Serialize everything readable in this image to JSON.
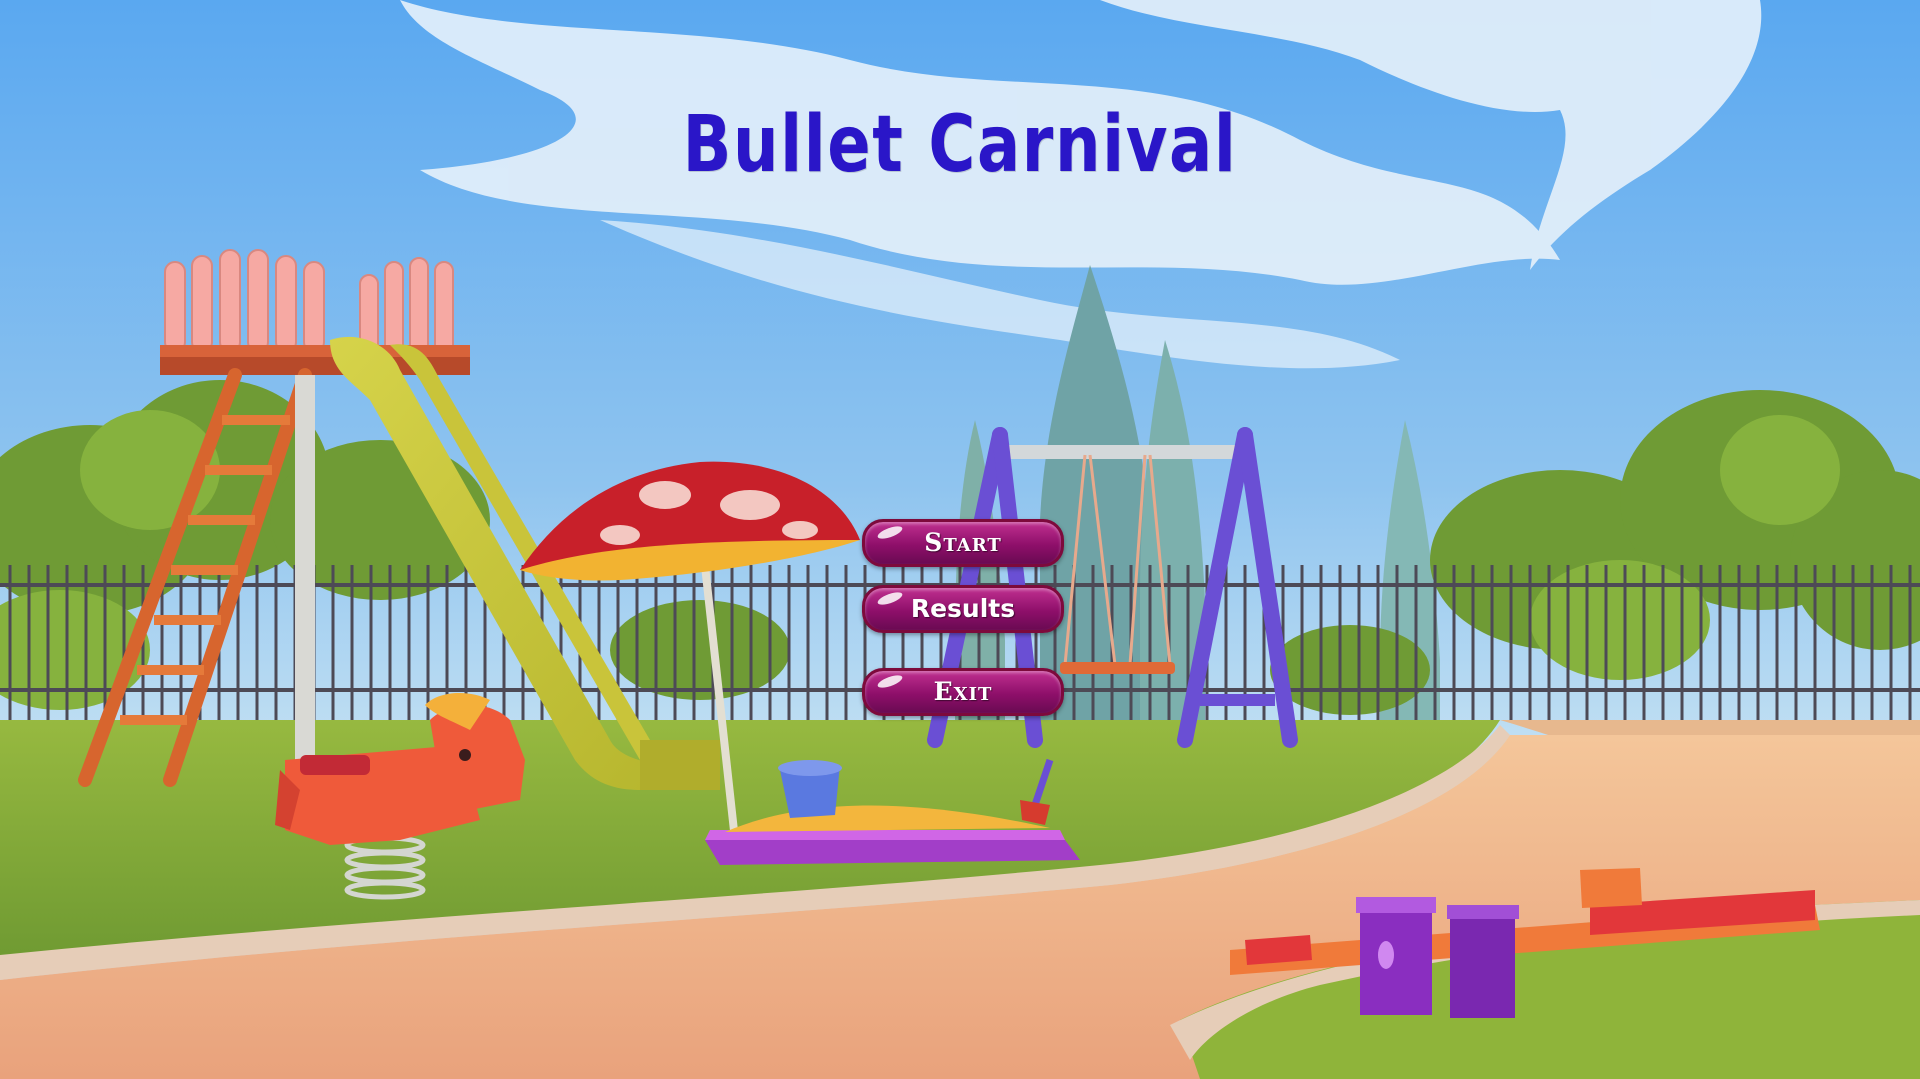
{
  "game": {
    "title": "Bullet Carnival",
    "title_color": "#2a16c8"
  },
  "menu": {
    "start_label": "Start",
    "results_label": "Results",
    "exit_label": "Exit"
  },
  "colors": {
    "sky_top": "#5aa8f0",
    "sky_bottom": "#cde6f4",
    "button_fill": "#9a1478",
    "button_border": "#7d0a3c",
    "grass": "#8fb43a",
    "path": "#f0b98a"
  }
}
